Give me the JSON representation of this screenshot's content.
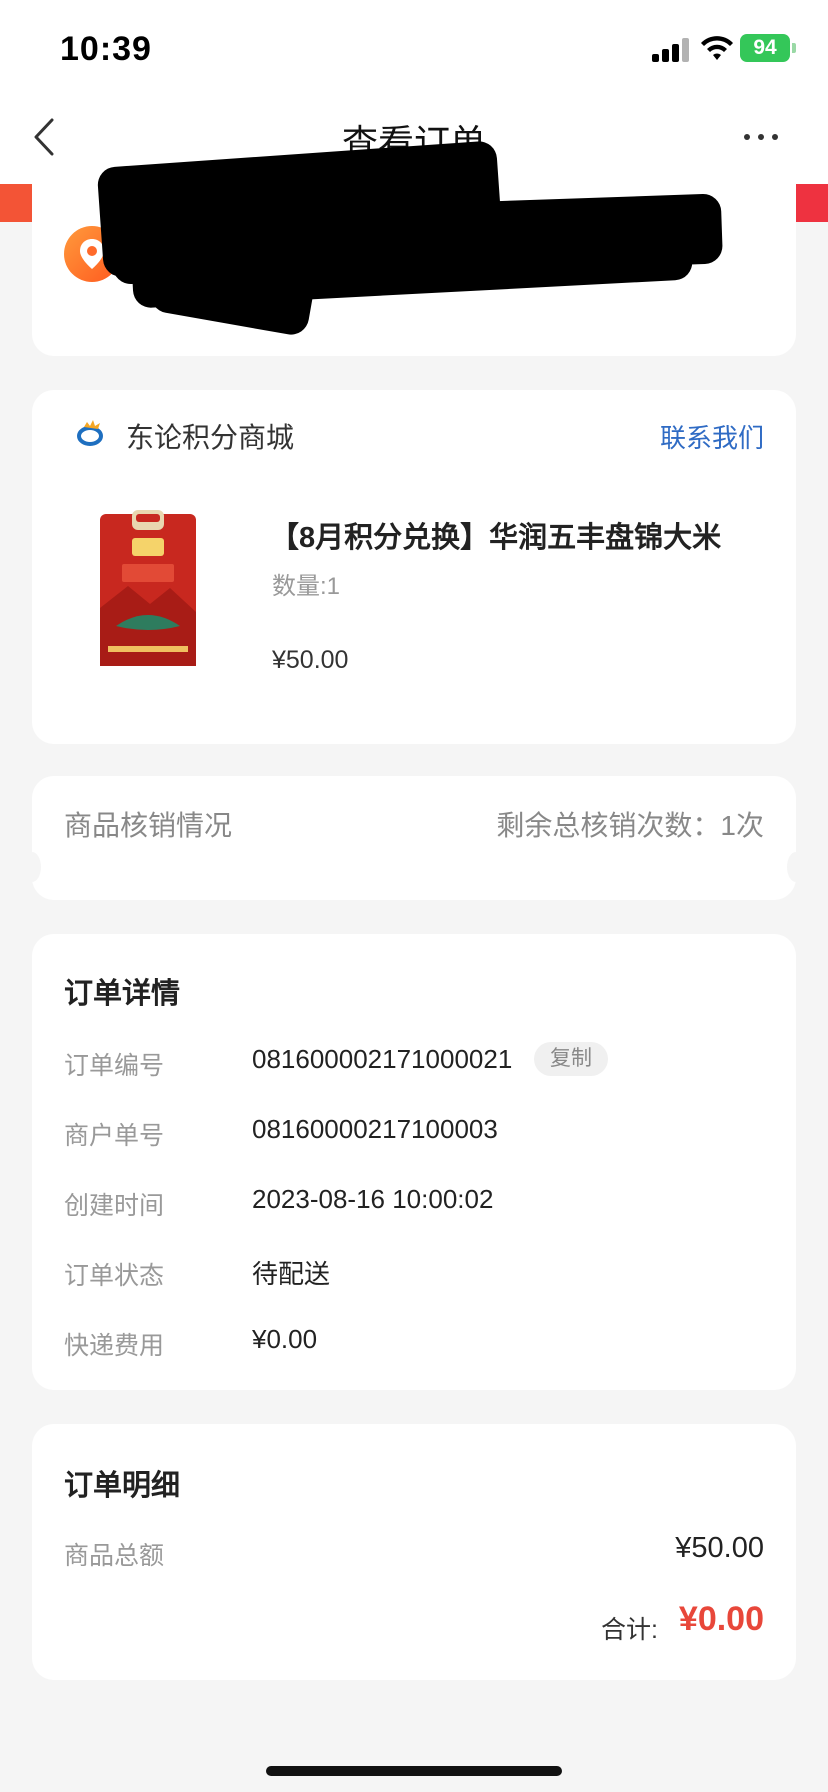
{
  "status_bar": {
    "time": "10:39",
    "battery": "94"
  },
  "nav": {
    "title": "查看订单"
  },
  "shop": {
    "name": "东论积分商城",
    "contact": "联系我们"
  },
  "product": {
    "title": "【8月积分兑换】华润五丰盘锦大米",
    "quantity": "数量:1",
    "price": "¥50.00"
  },
  "verification": {
    "label": "商品核销情况",
    "remaining": "剩余总核销次数：1次"
  },
  "order_details": {
    "heading": "订单详情",
    "copy_label": "复制",
    "rows": [
      {
        "label": "订单编号",
        "value": "081600002171000021"
      },
      {
        "label": "商户单号",
        "value": "08160000217100003"
      },
      {
        "label": "创建时间",
        "value": "2023-08-16 10:00:02"
      },
      {
        "label": "订单状态",
        "value": "待配送"
      },
      {
        "label": "快递费用",
        "value": "¥0.00"
      }
    ]
  },
  "order_summary": {
    "heading": "订单明细",
    "goods_total_label": "商品总额",
    "goods_total_value": "¥50.00",
    "total_label": "合计:",
    "total_value": "¥0.00"
  },
  "colors": {
    "accent_red": "#e8473a",
    "link_blue": "#2f6bc4",
    "location_orange": "#ff5a1f"
  }
}
